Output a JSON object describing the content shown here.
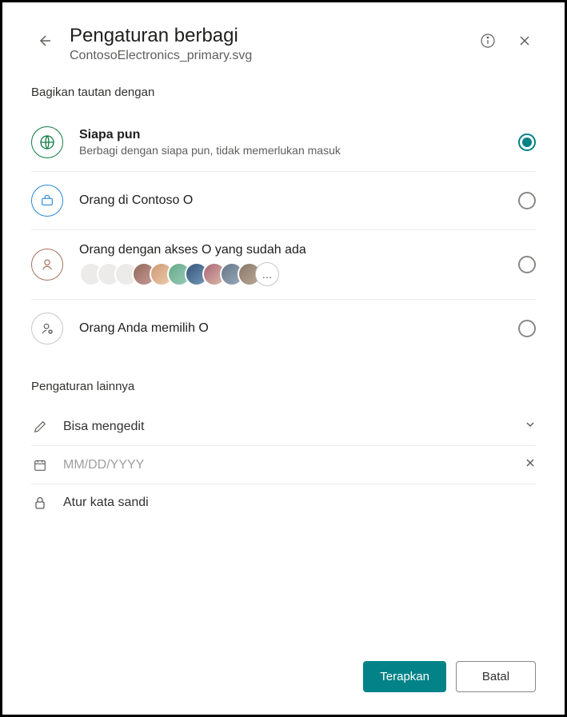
{
  "header": {
    "title": "Pengaturan berbagi",
    "subtitle": "ContosoElectronics_primary.svg"
  },
  "section_label": "Bagikan tautan dengan",
  "options": [
    {
      "title": "Siapa pun",
      "desc": "Berbagi dengan siapa pun, tidak memerlukan masuk",
      "selected": true
    },
    {
      "title": "Orang di Contoso O",
      "desc": "",
      "selected": false
    },
    {
      "title": "Orang dengan akses O yang sudah ada",
      "desc": "",
      "selected": false,
      "avatars_overflow": "…"
    },
    {
      "title": "Orang Anda memilih O",
      "desc": "",
      "selected": false
    }
  ],
  "more": {
    "label": "Pengaturan lainnya",
    "permission": "Bisa mengedit",
    "date_placeholder": "MM/DD/YYYY",
    "password_placeholder": "Atur kata sandi"
  },
  "buttons": {
    "apply": "Terapkan",
    "cancel": "Batal"
  }
}
